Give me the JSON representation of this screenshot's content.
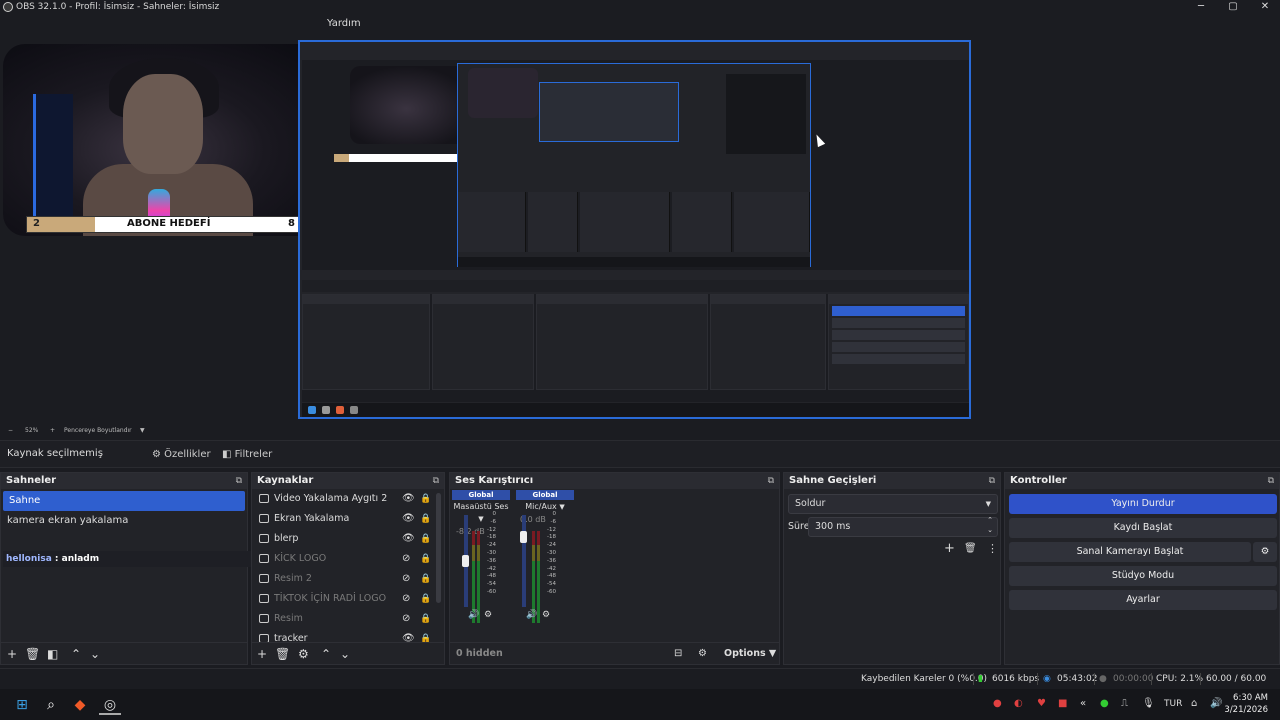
{
  "window": {
    "title": "OBS 32.1.0 - Profil: İsimsiz - Sahneler: İsimsiz",
    "menu_help": "Yardım"
  },
  "preview": {
    "goal_left": "2",
    "goal_title": "ABONE HEDEFİ",
    "goal_right": "8",
    "goal_progress": 0.25,
    "zoom_minus": "−",
    "zoom_level": "52%",
    "zoom_plus": "+",
    "zoom_mode": "Pencereye Boyutlandır"
  },
  "properties_bar": {
    "no_source": "Kaynak seçilmemiş",
    "properties": "Özellikler",
    "filters": "Filtreler"
  },
  "scenes": {
    "header": "Sahneler",
    "items": [
      "Sahne",
      "kamera ekran yakalama"
    ],
    "chat_user": "hellonisa",
    "chat_sep": " : ",
    "chat_text": "anladm"
  },
  "sources": {
    "header": "Kaynaklar",
    "items": [
      {
        "label": "Video Yakalama Aygıtı 2",
        "visible": true
      },
      {
        "label": "Ekran Yakalama",
        "visible": true
      },
      {
        "label": "blerp",
        "visible": true
      },
      {
        "label": "KİCK LOGO",
        "visible": false
      },
      {
        "label": "Resim 2",
        "visible": false
      },
      {
        "label": "TİKTOK İÇİN RADİ LOGO",
        "visible": false
      },
      {
        "label": "Resim",
        "visible": false
      },
      {
        "label": "tracker",
        "visible": true
      }
    ]
  },
  "mixer": {
    "header": "Ses Karıştırıcı",
    "ch1_global": "Global",
    "ch1_name": "Masaüstü Ses",
    "ch1_db": "-8.2 dB",
    "ch2_global": "Global",
    "ch2_name": "Mic/Aux",
    "ch2_db": "0.0 dB",
    "scale": [
      "0",
      "-6",
      "-12",
      "-18",
      "-24",
      "-30",
      "-36",
      "-42",
      "-48",
      "-54",
      "-60"
    ],
    "hidden": "0 hidden",
    "options": "Options"
  },
  "transitions": {
    "header": "Sahne Geçişleri",
    "selected": "Soldur",
    "duration_label": "Süre",
    "duration_value": "300 ms"
  },
  "controls": {
    "header": "Kontroller",
    "stop_stream": "Yayını Durdur",
    "start_record": "Kaydı Başlat",
    "virtual_cam": "Sanal Kamerayı Başlat",
    "studio_mode": "Stüdyo Modu",
    "settings": "Ayarlar"
  },
  "status": {
    "dropped": "Kaybedilen Kareler 0 (%0.0)",
    "bitrate": "6016 kbps",
    "stream_time": "05:43:02",
    "record_time": "00:00:00",
    "cpu": "CPU: 2.1%",
    "fps": "60.00 / 60.00 FPS"
  },
  "taskbar": {
    "lang": "TUR",
    "time": "6:30 AM",
    "date": "3/21/2026"
  },
  "colors": {
    "accent": "#2f5fcf",
    "active_button": "#2f52c9",
    "preview_border": "#2a6bd8",
    "goal_fill": "#c9a97a"
  }
}
